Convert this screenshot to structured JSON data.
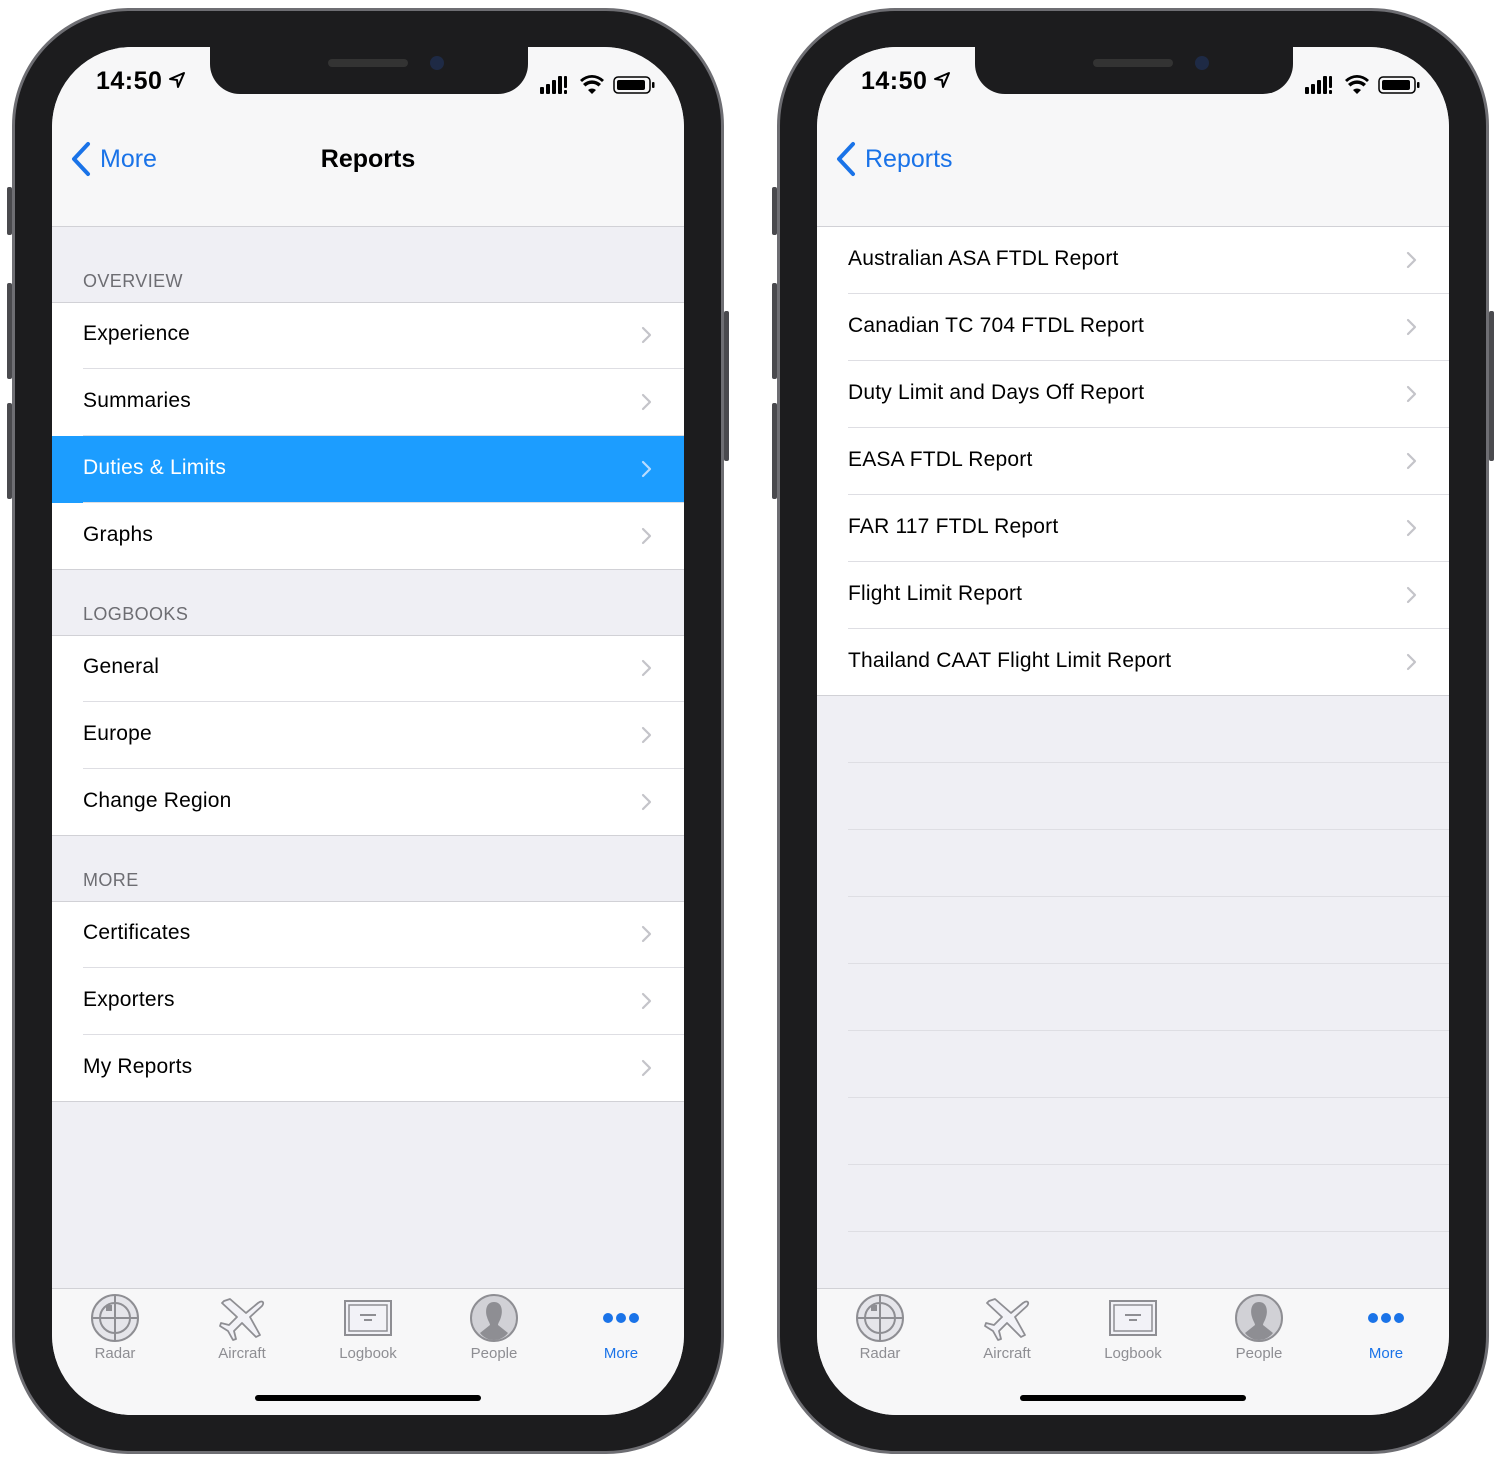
{
  "status": {
    "time": "14:50"
  },
  "left": {
    "nav": {
      "back_label": "More",
      "title": "Reports"
    },
    "sections": [
      {
        "header": "OVERVIEW",
        "items": [
          "Experience",
          "Summaries",
          "Duties & Limits",
          "Graphs"
        ]
      },
      {
        "header": "LOGBOOKS",
        "items": [
          "General",
          "Europe",
          "Change Region"
        ]
      },
      {
        "header": "MORE",
        "items": [
          "Certificates",
          "Exporters",
          "My Reports"
        ]
      }
    ],
    "selected_item": "Duties & Limits"
  },
  "right": {
    "nav": {
      "back_label": "Reports",
      "title": ""
    },
    "items": [
      "Australian ASA FTDL Report",
      "Canadian TC 704 FTDL Report",
      "Duty Limit and Days Off Report",
      "EASA FTDL Report",
      "FAR 117 FTDL Report",
      "Flight Limit Report",
      "Thailand CAAT Flight Limit Report"
    ]
  },
  "tabbar": {
    "items": [
      {
        "label": "Radar",
        "icon": "radar-icon"
      },
      {
        "label": "Aircraft",
        "icon": "aircraft-icon"
      },
      {
        "label": "Logbook",
        "icon": "logbook-icon"
      },
      {
        "label": "People",
        "icon": "people-icon"
      },
      {
        "label": "More",
        "icon": "more-icon"
      }
    ],
    "active": "More"
  },
  "colors": {
    "accent": "#1a73e8",
    "selection": "#1c9dff",
    "background": "#efeff4",
    "secondary_text": "#6d6d72",
    "inactive_tab": "#8e8e93"
  }
}
